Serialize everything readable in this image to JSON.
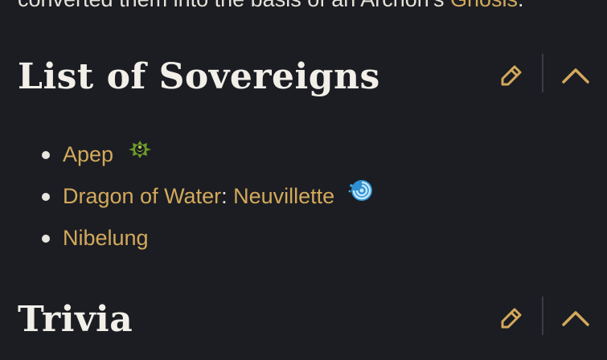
{
  "intro": {
    "text_before": "converted them into the basis of an Archon's ",
    "link": "Gnosis",
    "text_after": "."
  },
  "sections": [
    {
      "title": "List of Sovereigns",
      "edit_icon": "pencil-icon",
      "collapse_icon": "chevron-up-icon"
    },
    {
      "title": "Trivia",
      "edit_icon": "pencil-icon",
      "collapse_icon": "chevron-up-icon"
    }
  ],
  "sovereigns": [
    {
      "name": "Apep",
      "icon": "dendro-element-icon"
    },
    {
      "name": "Dragon of Water",
      "separator": ": ",
      "holder": "Neuvillette",
      "icon": "hydro-element-icon"
    },
    {
      "name": "Nibelung"
    }
  ],
  "colors": {
    "background": "#1b1d22",
    "link": "#d3a95c",
    "text": "#e9e6e0",
    "dendro": "#8bbd3a",
    "hydro": "#3fa6e0"
  }
}
